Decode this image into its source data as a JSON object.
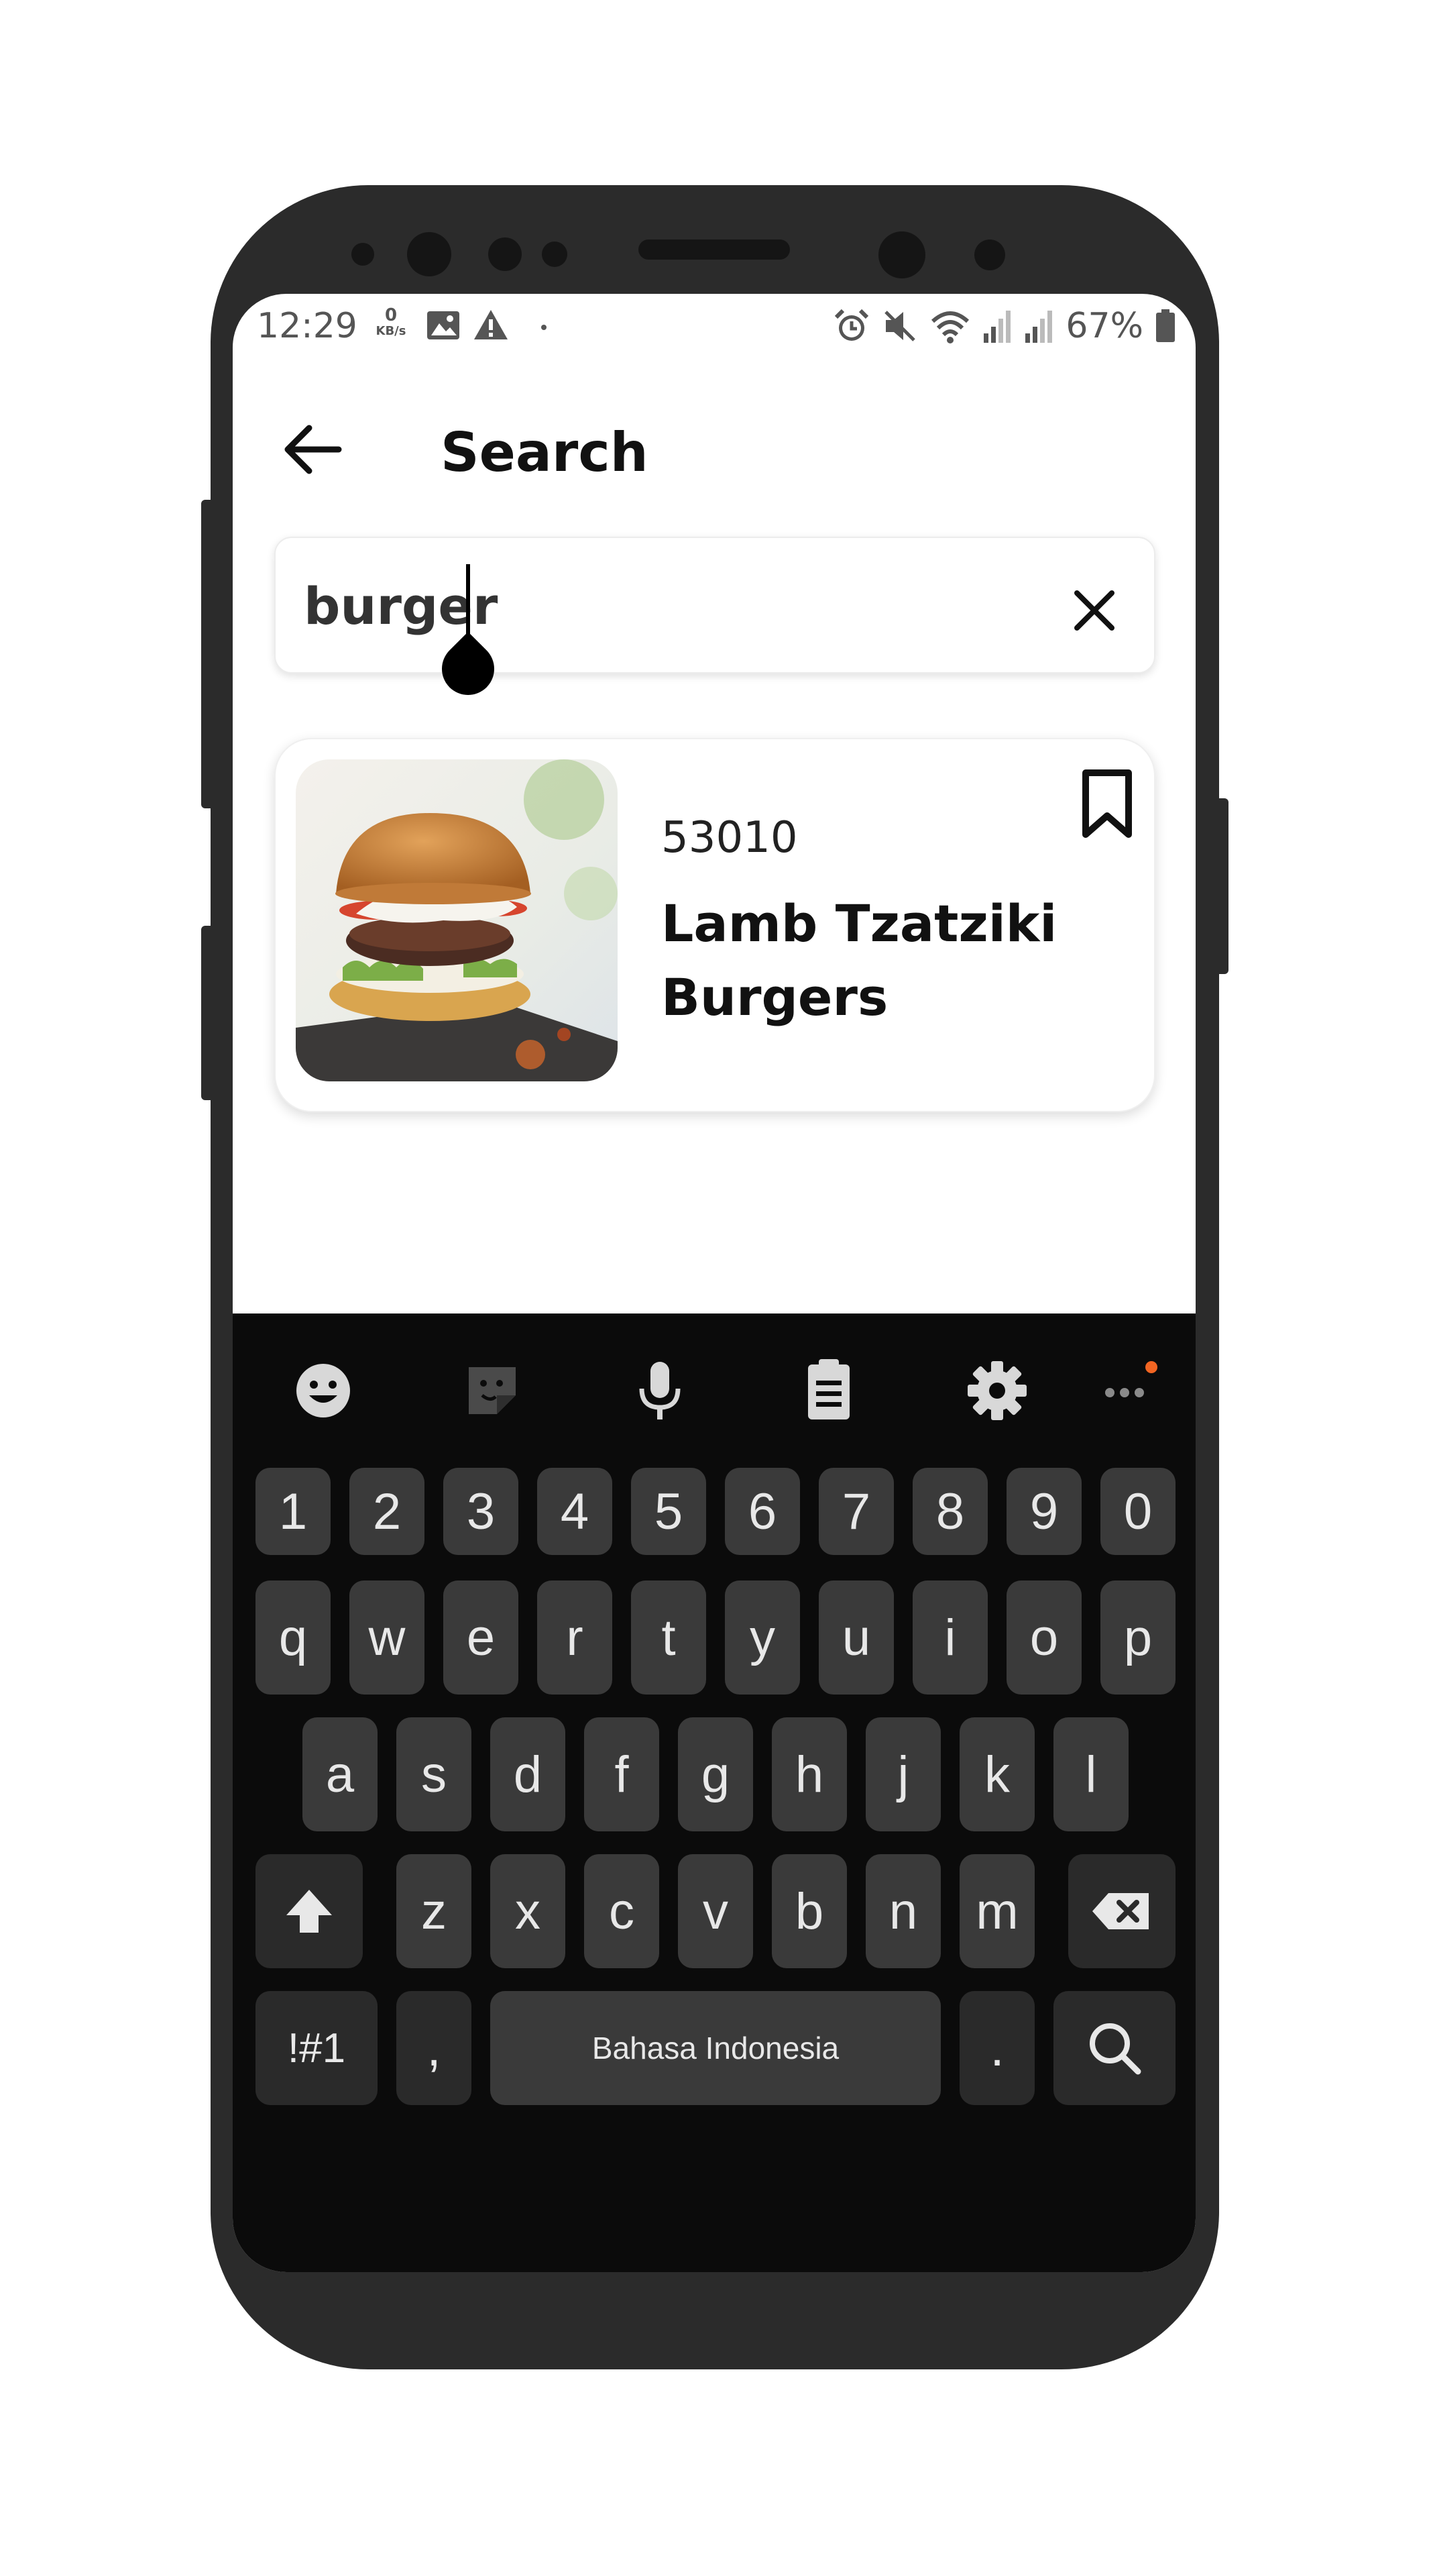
{
  "status_bar": {
    "time": "12:29",
    "net_speed_value": "0",
    "net_speed_unit": "KB/s",
    "battery": "67%"
  },
  "appbar": {
    "title": "Search"
  },
  "search": {
    "value": "burger"
  },
  "results": [
    {
      "id": "53010",
      "title": "Lamb Tzatziki Burgers"
    }
  ],
  "keyboard": {
    "number_row": [
      "1",
      "2",
      "3",
      "4",
      "5",
      "6",
      "7",
      "8",
      "9",
      "0"
    ],
    "row1": [
      "q",
      "w",
      "e",
      "r",
      "t",
      "y",
      "u",
      "i",
      "o",
      "p"
    ],
    "row2": [
      "a",
      "s",
      "d",
      "f",
      "g",
      "h",
      "j",
      "k",
      "l"
    ],
    "row3": [
      "z",
      "x",
      "c",
      "v",
      "b",
      "n",
      "m"
    ],
    "symbols_label": "!#1",
    "comma_label": ",",
    "space_label": "Bahasa Indonesia",
    "period_label": "."
  },
  "colors": {
    "frame": "#2b2b2b",
    "keyboard_bg": "#0b0b0b",
    "key_bg": "#3a3a3a",
    "notification_dot": "#f26522"
  }
}
